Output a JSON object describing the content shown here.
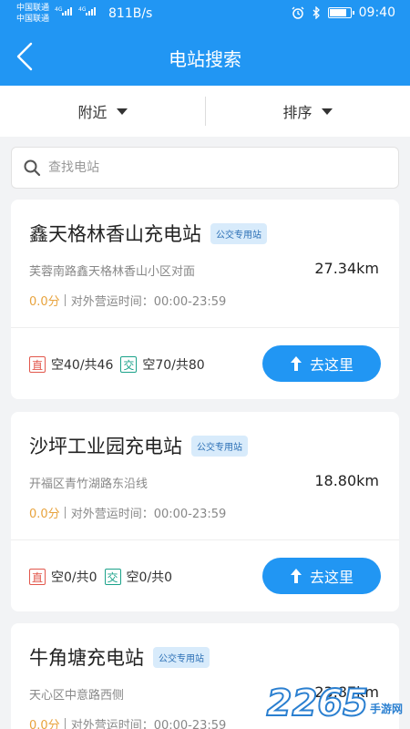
{
  "status_bar": {
    "carrier_1": "中国联通",
    "carrier_2": "中国联通",
    "network_1": "4G",
    "network_2": "4G",
    "net_speed": "811B/s",
    "time": "09:40",
    "battery_level": 0.85
  },
  "app_bar": {
    "title": "电站搜索"
  },
  "filters": {
    "nearby_label": "附近",
    "sort_label": "排序"
  },
  "search": {
    "placeholder": "查找电站",
    "value": ""
  },
  "stations": [
    {
      "name": "鑫天格林香山充电站",
      "tag": "公交专用站",
      "address": "芙蓉南路鑫天格林香山小区对面",
      "distance": "27.34km",
      "score": "0.0分",
      "hours": "对外营运时间：00:00-23:59",
      "dc_badge": "直",
      "dc_status": "空40/共46",
      "ac_badge": "交",
      "ac_status": "空70/共80",
      "go_label": "去这里"
    },
    {
      "name": "沙坪工业园充电站",
      "tag": "公交专用站",
      "address": "开福区青竹湖路东沿线",
      "distance": "18.80km",
      "score": "0.0分",
      "hours": "对外营运时间：00:00-23:59",
      "dc_badge": "直",
      "dc_status": "空0/共0",
      "ac_badge": "交",
      "ac_status": "空0/共0",
      "go_label": "去这里"
    },
    {
      "name": "牛角塘充电站",
      "tag": "公交专用站",
      "address": "天心区中意路西侧",
      "distance": "23.87km",
      "score": "0.0分",
      "hours": "对外营运时间：00:00-23:59"
    }
  ],
  "watermark": {
    "number": "2265",
    "suffix": "手游网"
  },
  "colors": {
    "primary": "#2196f3",
    "score": "#e8a33d",
    "dc": "#e2574c",
    "ac": "#1ba28a",
    "tag_bg": "#d8ebfb"
  }
}
